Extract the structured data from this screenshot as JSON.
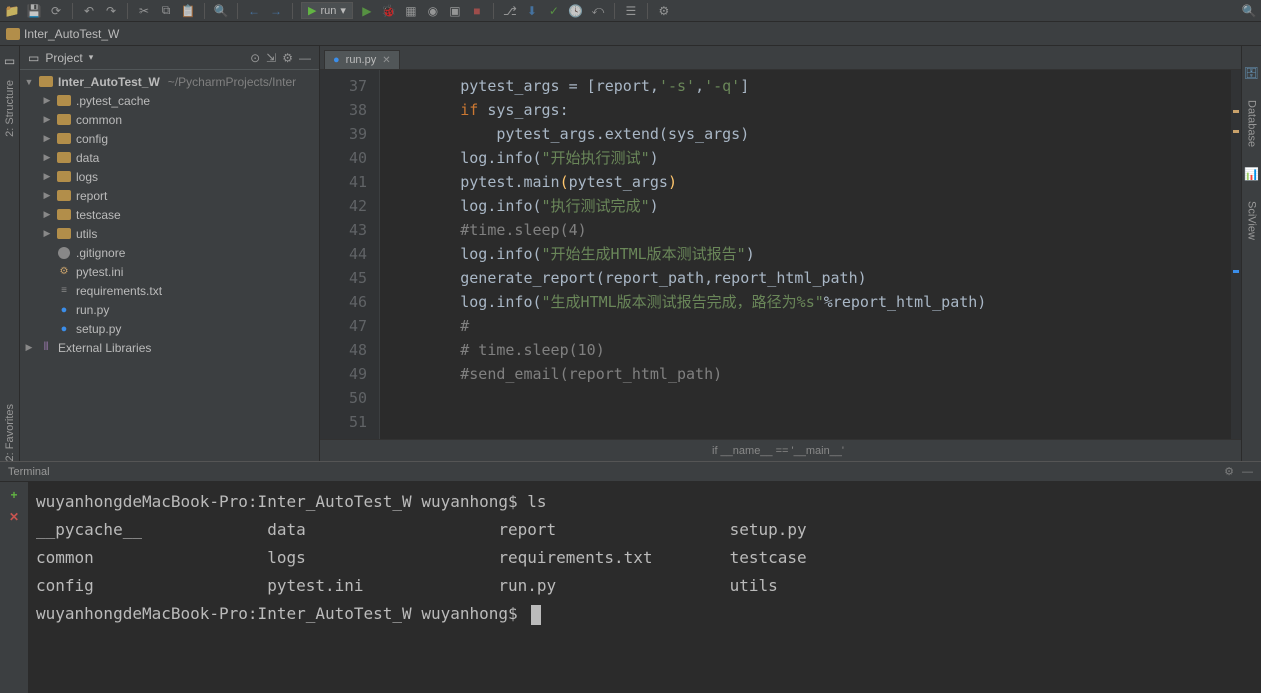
{
  "toolbar": {
    "run_config": "run",
    "run_arrow": "▾"
  },
  "breadcrumb": {
    "project": "Inter_AutoTest_W"
  },
  "project_panel": {
    "title": "Project",
    "root_name": "Inter_AutoTest_W",
    "root_path": "~/PycharmProjects/Inter",
    "items": [
      {
        "name": ".pytest_cache",
        "type": "folder"
      },
      {
        "name": "common",
        "type": "folder"
      },
      {
        "name": "config",
        "type": "folder"
      },
      {
        "name": "data",
        "type": "folder"
      },
      {
        "name": "logs",
        "type": "folder"
      },
      {
        "name": "report",
        "type": "folder"
      },
      {
        "name": "testcase",
        "type": "folder"
      },
      {
        "name": "utils",
        "type": "folder"
      },
      {
        "name": ".gitignore",
        "type": "git"
      },
      {
        "name": "pytest.ini",
        "type": "ini"
      },
      {
        "name": "requirements.txt",
        "type": "txt"
      },
      {
        "name": "run.py",
        "type": "py"
      },
      {
        "name": "setup.py",
        "type": "py"
      }
    ],
    "external": "External Libraries"
  },
  "editor": {
    "tab_name": "run.py",
    "line_start": 37,
    "lines": [
      {
        "n": 37,
        "html": "        pytest_args = [report,<span class='k-string'>'-s'</span>,<span class='k-string'>'-q'</span>]"
      },
      {
        "n": 38,
        "html": "        <span class='k-keyword'>if</span> sys_args:"
      },
      {
        "n": 39,
        "html": "            pytest_args.extend(sys_args)"
      },
      {
        "n": 40,
        "html": "        log.info(<span class='k-string'>\"开始执行测试\"</span>)"
      },
      {
        "n": 41,
        "html": "        pytest.main<span class='k-func'>(</span>pytest_args<span class='k-func'>)</span>"
      },
      {
        "n": 42,
        "html": "        log.info(<span class='k-string'>\"执行测试完成\"</span>)"
      },
      {
        "n": 43,
        "html": "        <span class='k-comment'>#time.sleep(4)</span>"
      },
      {
        "n": 44,
        "html": "        log.info(<span class='k-string'>\"开始生成HTML版本测试报告\"</span>)"
      },
      {
        "n": 45,
        "html": "        generate_report(report_path,report_html_path)"
      },
      {
        "n": 46,
        "html": "        log.info(<span class='k-string'>\"生成HTML版本测试报告完成，路径为%s\"</span>%report_html_path)"
      },
      {
        "n": 47,
        "html": "        <span class='k-comment'>#</span>"
      },
      {
        "n": 48,
        "html": "        <span class='k-comment'># time.sleep(10)</span>"
      },
      {
        "n": 49,
        "html": "        <span class='k-comment'>#send_email(report_html_path)</span>"
      },
      {
        "n": 50,
        "html": ""
      },
      {
        "n": 51,
        "html": ""
      }
    ],
    "bottom_crumb": "if __name__ == '__main__'"
  },
  "terminal": {
    "title": "Terminal",
    "prompt1": "wuyanhongdeMacBook-Pro:Inter_AutoTest_W wuyanhong$ ",
    "cmd1": "ls",
    "ls_output": {
      "col1": [
        "__pycache__",
        "common",
        "config"
      ],
      "col2": [
        "data",
        "logs",
        "pytest.ini"
      ],
      "col3": [
        "report",
        "requirements.txt",
        "run.py"
      ],
      "col4": [
        "setup.py",
        "testcase",
        "utils"
      ]
    },
    "prompt2": "wuyanhongdeMacBook-Pro:Inter_AutoTest_W wuyanhong$ "
  },
  "right_tools": {
    "database": "Database",
    "sciview": "SciView"
  }
}
